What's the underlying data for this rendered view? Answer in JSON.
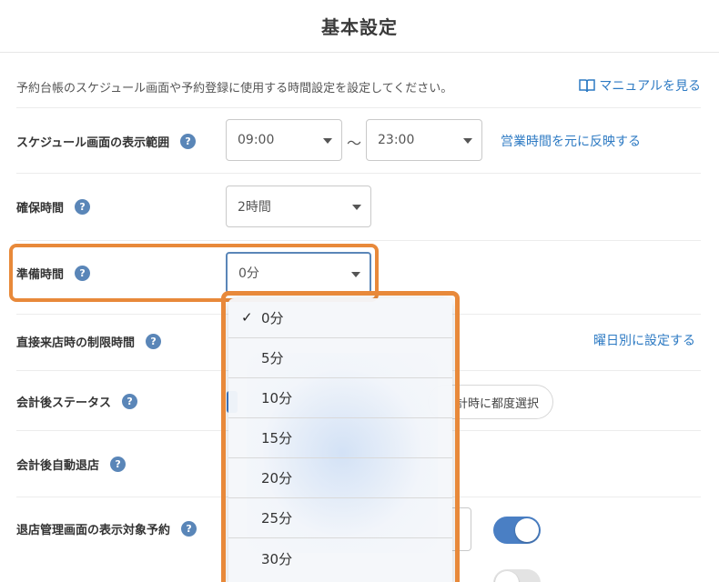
{
  "header": {
    "title": "基本設定"
  },
  "intro": {
    "description": "予約台帳のスケジュール画面や予約登録に使用する時間設定を設定してください。",
    "manual_link": "マニュアルを見る",
    "manual_icon": "book-icon"
  },
  "rows": {
    "schedule_range": {
      "label": "スケジュール画面の表示範囲",
      "start": "09:00",
      "separator": "〜",
      "end": "23:00",
      "link": "営業時間を元に反映する"
    },
    "reserve_time": {
      "label": "確保時間",
      "value": "2時間"
    },
    "prep_time": {
      "label": "準備時間",
      "value": "0分"
    },
    "walkin_limit": {
      "label": "直接来店時の制限時間",
      "link": "曜日別に設定する"
    },
    "post_checkout_status": {
      "label": "会計後ステータス",
      "option_partial": "計時に都度選択"
    },
    "auto_exit": {
      "label": "会計後自動退店"
    },
    "exit_display": {
      "label": "退店管理画面の表示対象予約"
    }
  },
  "help_symbol": "?",
  "dropdown": {
    "selected_index": 0,
    "check_mark": "✓",
    "options": [
      "0分",
      "5分",
      "10分",
      "15分",
      "20分",
      "25分",
      "30分"
    ]
  },
  "colors": {
    "accent_orange": "#e8893a",
    "link_blue": "#2d7ac3",
    "help_blue": "#5a86b8",
    "toggle_on": "#4a7fc4"
  }
}
